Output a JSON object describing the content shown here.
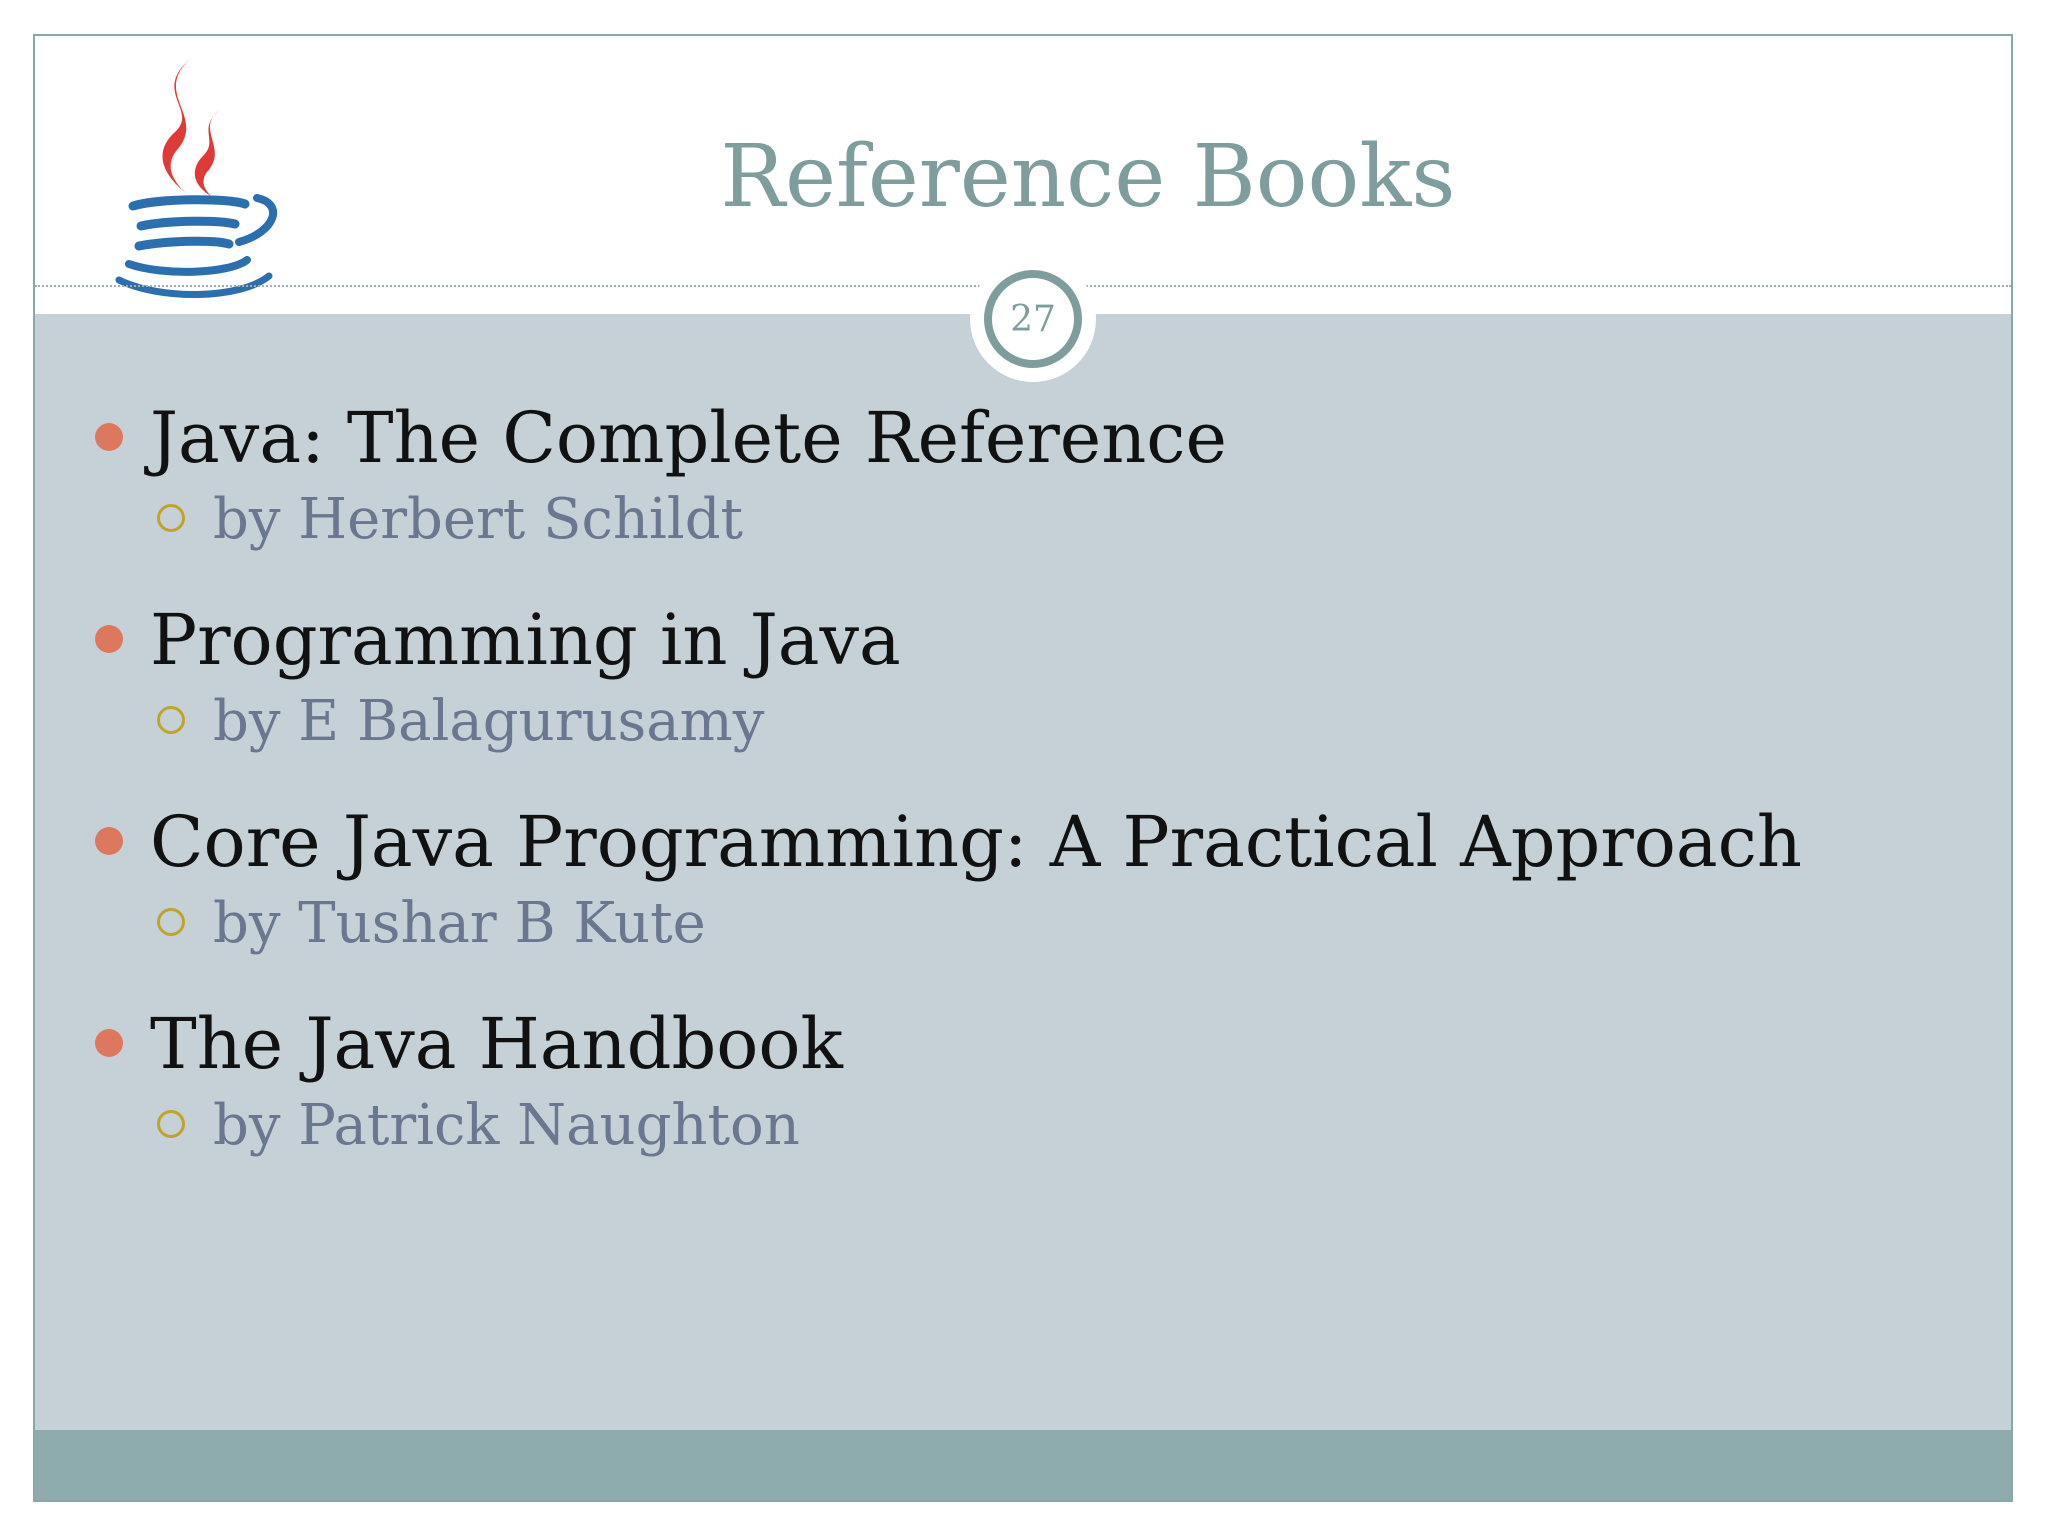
{
  "slide": {
    "title": "Reference Books",
    "page_number": "27",
    "logo_icon": "java-coffee-cup-icon"
  },
  "books": [
    {
      "title": "Java: The Complete Reference",
      "author": "by Herbert Schildt"
    },
    {
      "title": "Programming in Java",
      "author": "by E Balagurusamy"
    },
    {
      "title": "Core Java Programming: A Practical Approach",
      "author": "by Tushar B Kute"
    },
    {
      "title": "The Java Handbook",
      "author": "by Patrick Naughton"
    }
  ],
  "colors": {
    "title": "#7f9d9d",
    "content_background": "#c5d1d6",
    "footer_bar": "#8eabae",
    "bullet": "#dd785e",
    "sub_bullet": "#c2a32a",
    "book_title_text": "#111111",
    "author_text": "#6b7690",
    "logo_steam": "#e03a36",
    "logo_cup": "#2a6fb0"
  }
}
